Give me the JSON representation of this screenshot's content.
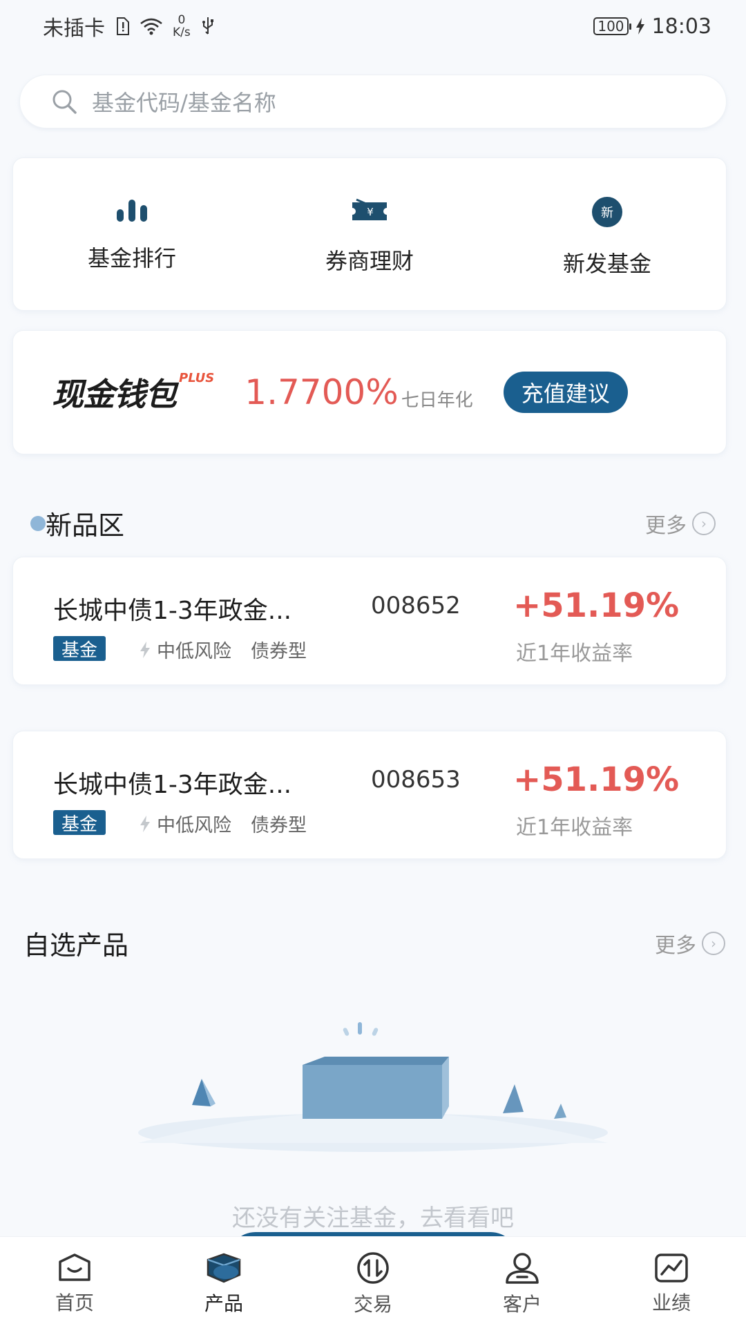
{
  "status_bar": {
    "carrier": "未插卡",
    "net_speed_value": "0",
    "net_speed_unit": "K/s",
    "battery": "100",
    "time": "18:03"
  },
  "search": {
    "placeholder": "基金代码/基金名称"
  },
  "shortcuts": [
    {
      "label": "基金排行",
      "icon": "bar-chart-icon"
    },
    {
      "label": "券商理财",
      "icon": "ticket-yen-icon"
    },
    {
      "label": "新发基金",
      "icon": "new-badge-icon",
      "badge_text": "新"
    }
  ],
  "cash_wallet": {
    "logo_text": "现金钱包",
    "logo_suffix": "PLUS",
    "rate": "1.7700%",
    "rate_label": "七日年化",
    "button": "充值建议"
  },
  "new_products": {
    "title": "新品区",
    "more": "更多",
    "items": [
      {
        "name": "长城中债1-3年政金...",
        "code": "008652",
        "yield": "+51.19%",
        "yield_label": "近1年收益率",
        "tag": "基金",
        "risk": "中低风险",
        "type": "债券型"
      },
      {
        "name": "长城中债1-3年政金...",
        "code": "008653",
        "yield": "+51.19%",
        "yield_label": "近1年收益率",
        "tag": "基金",
        "risk": "中低风险",
        "type": "债券型"
      }
    ]
  },
  "watchlist": {
    "title": "自选产品",
    "more": "更多",
    "empty_text": "还没有关注基金，去看看吧"
  },
  "bottom_nav": [
    {
      "label": "首页",
      "icon": "home-icon",
      "active": false
    },
    {
      "label": "产品",
      "icon": "product-box-icon",
      "active": true
    },
    {
      "label": "交易",
      "icon": "trade-arrows-icon",
      "active": false
    },
    {
      "label": "客户",
      "icon": "user-icon",
      "active": false
    },
    {
      "label": "业绩",
      "icon": "performance-chart-icon",
      "active": false
    }
  ],
  "colors": {
    "brand": "#1a5f8f",
    "rise": "#e35a55",
    "muted": "#999999"
  }
}
